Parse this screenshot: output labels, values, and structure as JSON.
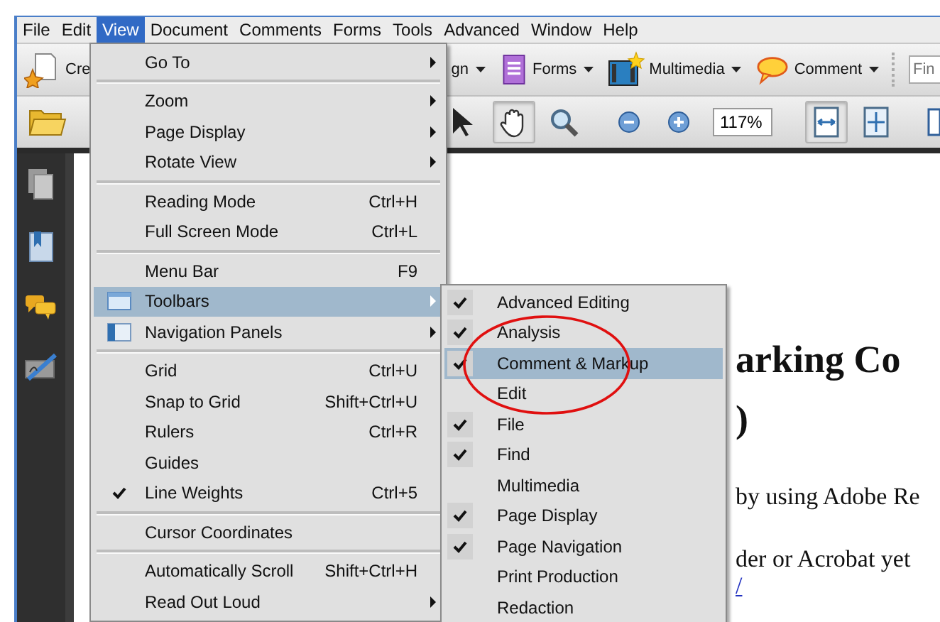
{
  "menubar": [
    {
      "label": "File",
      "selected": false
    },
    {
      "label": "Edit",
      "selected": false
    },
    {
      "label": "View",
      "selected": true
    },
    {
      "label": "Document",
      "selected": false
    },
    {
      "label": "Comments",
      "selected": false
    },
    {
      "label": "Forms",
      "selected": false
    },
    {
      "label": "Tools",
      "selected": false
    },
    {
      "label": "Advanced",
      "selected": false
    },
    {
      "label": "Window",
      "selected": false
    },
    {
      "label": "Help",
      "selected": false
    }
  ],
  "toolbar_top": {
    "create_label": "Cre",
    "sign_label": "gn",
    "buttons": [
      {
        "kind": "forms",
        "label": "Forms"
      },
      {
        "kind": "multimedia",
        "label": "Multimedia"
      },
      {
        "kind": "comment",
        "label": "Comment"
      }
    ],
    "search": {
      "placeholder": "Fin"
    }
  },
  "toolbar_bottom": {
    "zoom_value": "117%",
    "tools_left": [
      {
        "kind": "pointer",
        "selected": false
      },
      {
        "kind": "hand",
        "selected": true
      },
      {
        "kind": "magnifier",
        "selected": false
      },
      {
        "kind": "separator"
      },
      {
        "kind": "zoom-out",
        "selected": false
      },
      {
        "kind": "zoom-in",
        "selected": false
      }
    ],
    "tools_right": [
      {
        "kind": "separator"
      },
      {
        "kind": "fit-width",
        "selected": true
      },
      {
        "kind": "fit-page",
        "selected": false
      },
      {
        "kind": "separator"
      },
      {
        "kind": "two-page",
        "selected": false
      }
    ]
  },
  "view_menu": {
    "items": [
      {
        "kind": "item",
        "label": "Go To",
        "submenu": true,
        "checked": false,
        "selected": false
      },
      {
        "kind": "separator"
      },
      {
        "kind": "item",
        "label": "Zoom",
        "submenu": true,
        "checked": false,
        "selected": false
      },
      {
        "kind": "item",
        "label": "Page Display",
        "submenu": true,
        "checked": false,
        "selected": false
      },
      {
        "kind": "item",
        "label": "Rotate View",
        "submenu": true,
        "checked": false,
        "selected": false
      },
      {
        "kind": "separator"
      },
      {
        "kind": "item",
        "label": "Reading Mode",
        "shortcut": "Ctrl+H",
        "submenu": false,
        "checked": false,
        "selected": false
      },
      {
        "kind": "item",
        "label": "Full Screen Mode",
        "shortcut": "Ctrl+L",
        "submenu": false,
        "checked": false,
        "selected": false
      },
      {
        "kind": "separator"
      },
      {
        "kind": "item",
        "label": "Menu Bar",
        "shortcut": "F9",
        "submenu": false,
        "checked": false,
        "selected": false
      },
      {
        "kind": "toolbar_item",
        "label": "Toolbars",
        "submenu": true,
        "checked": false,
        "selected": true
      },
      {
        "kind": "panel_item",
        "label": "Navigation Panels",
        "submenu": true,
        "checked": false,
        "selected": false
      },
      {
        "kind": "separator"
      },
      {
        "kind": "item",
        "label": "Grid",
        "shortcut": "Ctrl+U",
        "submenu": false,
        "checked": false,
        "selected": false
      },
      {
        "kind": "item",
        "label": "Snap to Grid",
        "shortcut": "Shift+Ctrl+U",
        "submenu": false,
        "checked": false,
        "selected": false
      },
      {
        "kind": "item",
        "label": "Rulers",
        "shortcut": "Ctrl+R",
        "submenu": false,
        "checked": false,
        "selected": false
      },
      {
        "kind": "item",
        "label": "Guides",
        "submenu": false,
        "checked": false,
        "selected": false
      },
      {
        "kind": "item",
        "label": "Line Weights",
        "shortcut": "Ctrl+5",
        "submenu": false,
        "checked": true,
        "selected": false
      },
      {
        "kind": "separator"
      },
      {
        "kind": "item",
        "label": "Cursor Coordinates",
        "submenu": false,
        "checked": false,
        "selected": false
      },
      {
        "kind": "separator"
      },
      {
        "kind": "item",
        "label": "Automatically Scroll",
        "shortcut": "Shift+Ctrl+H",
        "submenu": false,
        "checked": false,
        "selected": false
      },
      {
        "kind": "item",
        "label": "Read Out Loud",
        "submenu": true,
        "checked": false,
        "selected": false
      }
    ]
  },
  "toolbars_submenu": {
    "items": [
      {
        "label": "Advanced Editing",
        "checked": true,
        "selected": false
      },
      {
        "label": "Analysis",
        "checked": true,
        "selected": false
      },
      {
        "label": "Comment & Markup",
        "checked": true,
        "selected": true
      },
      {
        "label": "Edit",
        "checked": false,
        "selected": false
      },
      {
        "label": "File",
        "checked": true,
        "selected": false
      },
      {
        "label": "Find",
        "checked": true,
        "selected": false
      },
      {
        "label": "Multimedia",
        "checked": false,
        "selected": false
      },
      {
        "label": "Page Display",
        "checked": true,
        "selected": false
      },
      {
        "label": "Page Navigation",
        "checked": true,
        "selected": false
      },
      {
        "label": "Print Production",
        "checked": false,
        "selected": false
      },
      {
        "label": "Redaction",
        "checked": false,
        "selected": false
      }
    ]
  },
  "document": {
    "heading_lines": [
      "arking Co",
      ")"
    ],
    "paragraphs": [
      "by using Adobe Re",
      "der or Acrobat yet"
    ],
    "link": "/"
  }
}
